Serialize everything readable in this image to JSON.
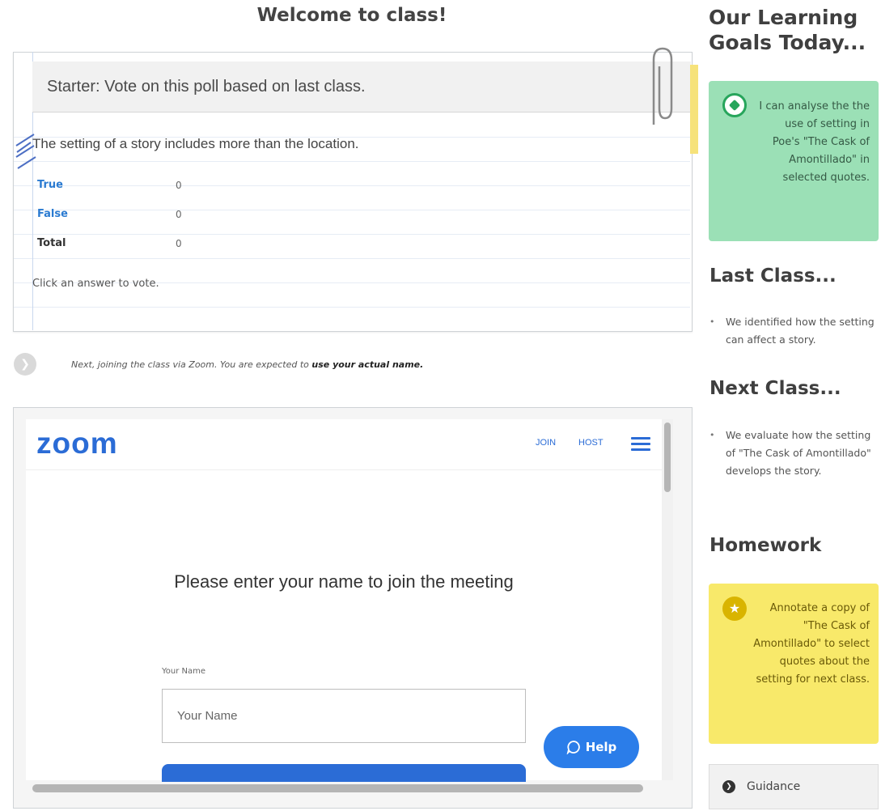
{
  "main": {
    "welcome_title": "Welcome to class!",
    "poll": {
      "header": "Starter: Vote on this poll based on last class.",
      "question": "The setting of a story includes more than the location.",
      "options": [
        {
          "label": "True",
          "count": "0"
        },
        {
          "label": "False",
          "count": "0"
        }
      ],
      "total_label": "Total",
      "total_count": "0",
      "hint": "Click an answer to vote."
    },
    "next_step": {
      "text": "Next, joining the class via Zoom. You are expected to ",
      "emphasis": "use your actual name."
    },
    "zoom": {
      "logo": "zoom",
      "nav_join": "JOIN",
      "nav_host": "HOST",
      "heading": "Please enter your name to join the meeting",
      "name_label": "Your Name",
      "name_placeholder": "Your Name",
      "help_label": "Help"
    }
  },
  "sidebar": {
    "goals_title": "Our Learning Goals Today...",
    "goal_text": "I can analyse the the use of setting in Poe's \"The Cask of Amontillado\" in selected quotes.",
    "last_class_title": "Last Class...",
    "last_class_items": [
      "We identified how the setting can affect a story."
    ],
    "next_class_title": "Next Class...",
    "next_class_items": [
      "We evaluate how the setting of \"The Cask of Amontillado\" develops the story."
    ],
    "homework_title": "Homework",
    "homework_text": "Annotate a copy of \"The Cask of Amontillado\" to select quotes about the setting for next class.",
    "guidance_label": "Guidance"
  },
  "colors": {
    "zoom_blue": "#2b6cd6",
    "goal_green": "#9be0b6",
    "homework_yellow": "#f8e96a",
    "poll_link_blue": "#2b7bd1"
  }
}
